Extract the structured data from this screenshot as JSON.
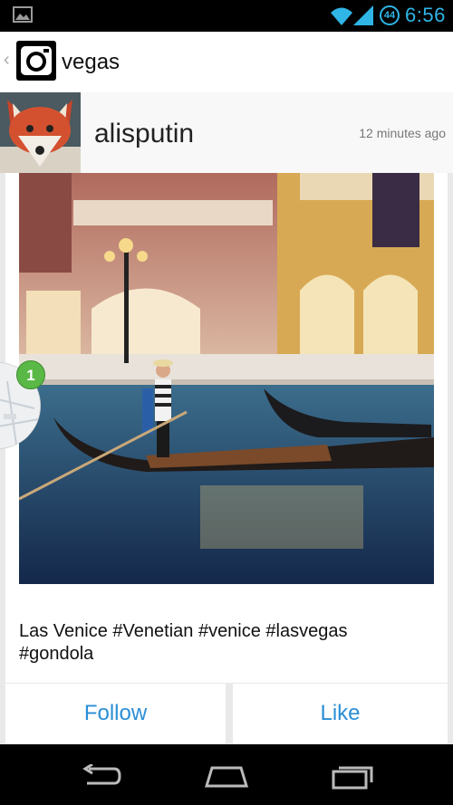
{
  "status_bar": {
    "time": "6:56",
    "battery_level": "44",
    "icons": [
      "gallery-notification-icon",
      "wifi-icon",
      "cell-signal-icon",
      "battery-icon"
    ]
  },
  "action_bar": {
    "title": "vegas",
    "icons": [
      "back-chevron-icon",
      "instagram-camera-icon"
    ]
  },
  "post": {
    "username": "alisputin",
    "time_ago": "12 minutes ago",
    "caption": "Las Venice #Venetian #venice #lasvegas #gondola",
    "location_count": "1"
  },
  "actions": {
    "follow_label": "Follow",
    "like_label": "Like"
  },
  "nav_bar": {
    "icons": [
      "back-icon",
      "home-icon",
      "recent-apps-icon"
    ]
  },
  "colors": {
    "accent": "#2fb5e6",
    "button_text": "#2b8ed6",
    "badge_green": "#5ab946"
  }
}
